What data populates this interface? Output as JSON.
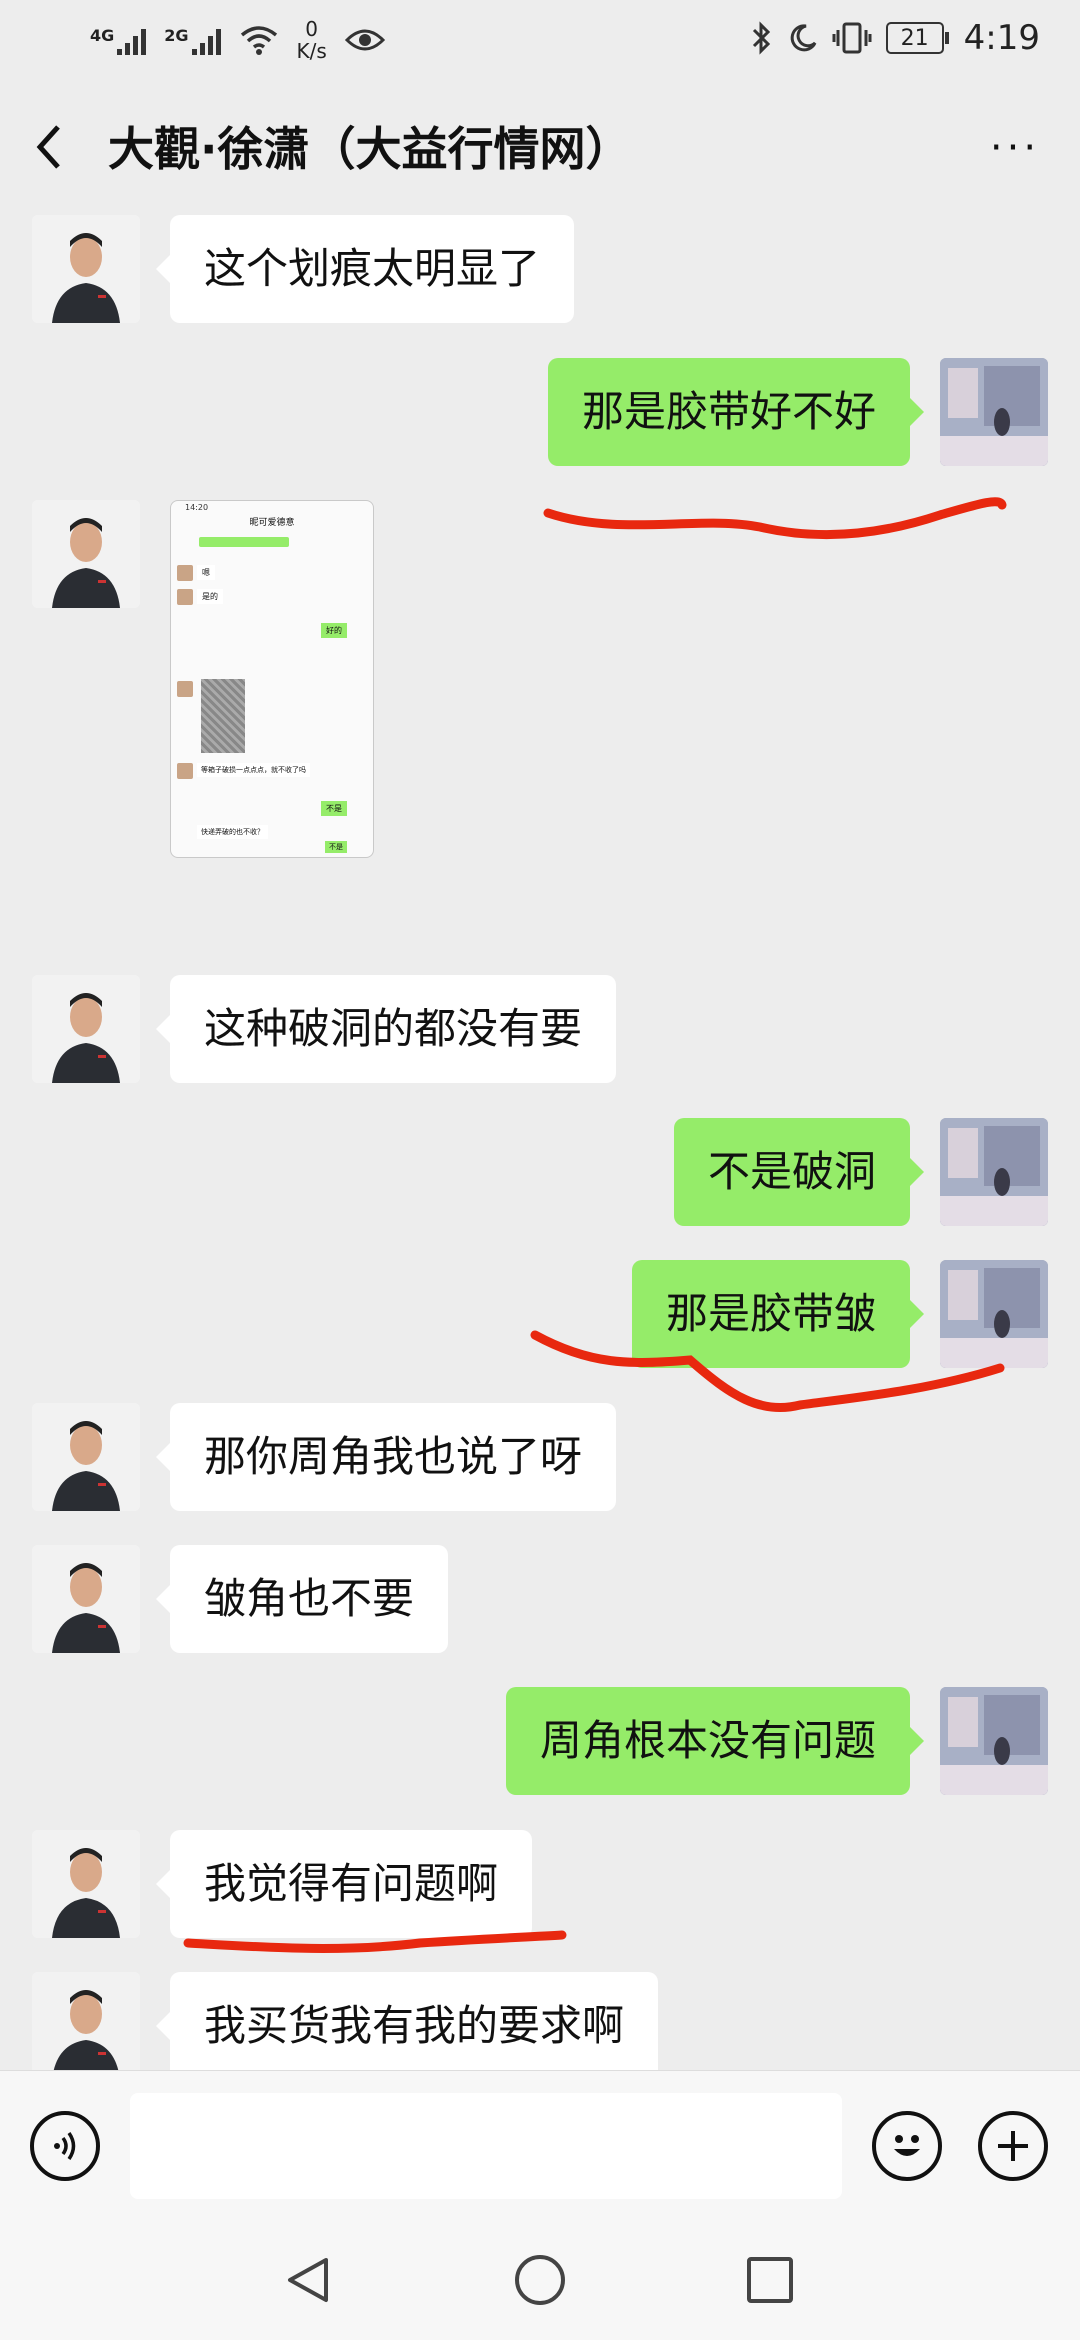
{
  "status_bar": {
    "net1": "4G",
    "net2": "2G",
    "speed_value": "0",
    "speed_unit": "K/s",
    "battery": "21",
    "time": "4:19"
  },
  "header": {
    "title": "大觀·徐潇（大益行情网）",
    "more_label": "···"
  },
  "messages": [
    {
      "side": "other",
      "text": "这个划痕太明显了"
    },
    {
      "side": "me",
      "text": "那是胶带好不好"
    },
    {
      "side": "other",
      "type": "image"
    },
    {
      "side": "other",
      "text": "这种破洞的都没有要"
    },
    {
      "side": "me",
      "text": "不是破洞"
    },
    {
      "side": "me",
      "text": "那是胶带皱"
    },
    {
      "side": "other",
      "text": "那你周角我也说了呀"
    },
    {
      "side": "other",
      "text": "皱角也不要"
    },
    {
      "side": "me",
      "text": "周角根本没有问题"
    },
    {
      "side": "other",
      "text": "我觉得有问题啊"
    },
    {
      "side": "other",
      "text": "我买货我有我的要求啊"
    }
  ],
  "thumbnail": {
    "time": "14:20",
    "title": "昵可爱德意",
    "m1": "嗯",
    "m2": "是的",
    "m3": "好的",
    "m4": "等箱子破损一点点点，就不收了吗",
    "m5": "不是",
    "m6": "快递弄破的也不收？",
    "m7": "不是"
  },
  "colors": {
    "my_bubble": "#95ec69",
    "other_bubble": "#ffffff",
    "chat_bg": "#ededed",
    "annotation": "#e8280f"
  },
  "icons": {
    "voice": "voice-icon",
    "emoji": "emoji-icon",
    "add": "add-icon",
    "back": "back-icon",
    "home": "home-icon",
    "recents": "recents-icon"
  }
}
